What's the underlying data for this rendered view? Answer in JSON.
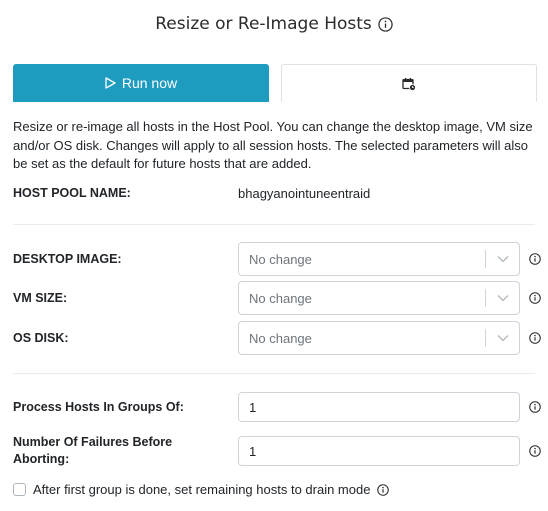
{
  "header": {
    "title": "Resize or Re-Image Hosts"
  },
  "tabs": [
    {
      "label": "Run now",
      "icon": "play-icon",
      "active": true
    },
    {
      "label": "",
      "icon": "calendar-clock-icon",
      "active": false
    }
  ],
  "description": "Resize or re-image all hosts in the Host Pool. You can change the desktop image, VM size and/or OS disk. Changes will apply to all session hosts. The selected parameters will also be set as the default for future hosts that are added.",
  "host_pool": {
    "label": "HOST POOL NAME:",
    "value": "bhagyanointuneentraid"
  },
  "fields": {
    "desktop_image": {
      "label": "DESKTOP IMAGE:",
      "value": "No change"
    },
    "vm_size": {
      "label": "VM SIZE:",
      "value": "No change"
    },
    "os_disk": {
      "label": "OS DISK:",
      "value": "No change"
    },
    "groups": {
      "label": "Process Hosts In Groups Of:",
      "value": "1"
    },
    "failures": {
      "label": "Number Of Failures Before Aborting:",
      "value": "1"
    }
  },
  "drain": {
    "label": "After first group is done, set remaining hosts to drain mode",
    "checked": false
  },
  "colors": {
    "accent": "#1e9cc0",
    "border": "#ced4da",
    "muted": "#6c757d"
  }
}
